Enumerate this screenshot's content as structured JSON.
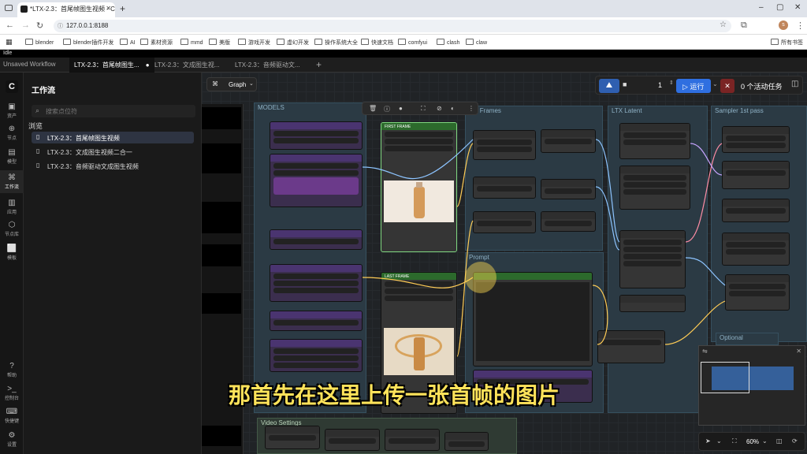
{
  "browser": {
    "tab_title": "*LTX-2.3：首尾帧图生视频 - C",
    "url": "127.0.0.1:8188",
    "bookmarks": [
      "blender",
      "blender插件开发",
      "AI",
      "素材资源",
      "mmd",
      "美版",
      "游戏开发",
      "虚幻开发",
      "操作系统大全",
      "快速文档",
      "comfyui",
      "clash",
      "claw"
    ],
    "all_bookmarks": "所有书签"
  },
  "app": {
    "status": "Idle",
    "tabs": [
      {
        "label": "Unsaved Workflow"
      },
      {
        "label": "LTX-2.3：首尾帧图生..."
      },
      {
        "label": "LTX-2.3：文成图生视..."
      },
      {
        "label": "LTX-2.3：音频驱动文..."
      }
    ],
    "rail": [
      {
        "icon": "cube-icon",
        "label": "资产"
      },
      {
        "icon": "node-icon",
        "label": "节点"
      },
      {
        "icon": "model-icon",
        "label": "模型"
      },
      {
        "icon": "workflow-icon",
        "label": "工作流"
      },
      {
        "icon": "app-icon",
        "label": "应用"
      },
      {
        "icon": "library-icon",
        "label": "节点库"
      },
      {
        "icon": "template-icon",
        "label": "模板"
      },
      {
        "icon": "help-icon",
        "label": "帮助"
      },
      {
        "icon": "terminal-icon",
        "label": "控制台"
      },
      {
        "icon": "keyboard-icon",
        "label": "快捷键"
      },
      {
        "icon": "settings-icon",
        "label": "设置"
      }
    ],
    "panel": {
      "title": "工作流",
      "search_placeholder": "搜索点位符",
      "section": "浏览",
      "items": [
        {
          "label": "LTX-2.3：首尾帧图生视频"
        },
        {
          "label": "LTX-2.3：文成图生视频二合一"
        },
        {
          "label": "LTX-2.3：音频驱动文成图生视频"
        }
      ]
    },
    "canvas": {
      "graph_label": "Graph",
      "queue_count": "1",
      "run_label": "运行",
      "tasks_label": "0 个活动任务",
      "zoom": "60%"
    },
    "groups": [
      "MODELS",
      "ure Frames",
      "LTX Latent",
      "Sampler 1st pass",
      "Prompt",
      "Video Settings",
      "Optional"
    ],
    "nodes": {
      "first_frame": "FIRST FRAME",
      "last_frame": "LAST FRAME"
    },
    "subtitle": "那首先在这里上传一张首帧的图片"
  }
}
